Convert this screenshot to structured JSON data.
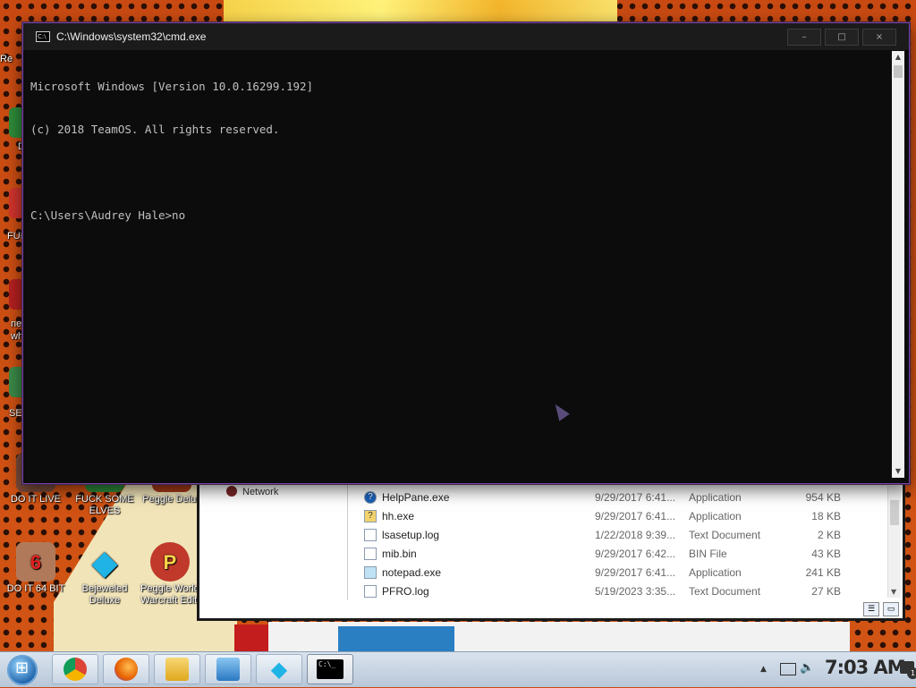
{
  "cmd": {
    "title": "C:\\Windows\\system32\\cmd.exe",
    "lines": [
      "Microsoft Windows [Version 10.0.16299.192]",
      "(c) 2018 TeamOS. All rights reserved.",
      "",
      "C:\\Users\\Audrey Hale>no"
    ],
    "controls": {
      "minimize": "–",
      "maximize": "□",
      "close": "×"
    }
  },
  "desktop": {
    "icons": [
      {
        "label": "DO IT LIVE",
        "color": "#7b4b3a",
        "glyph": ""
      },
      {
        "label": "FUCK SOME ELVES",
        "color": "#2e8b3a",
        "glyph": ""
      },
      {
        "label": "Peggle Delux",
        "color": "#a63a18",
        "glyph": "P"
      },
      {
        "label": "DO IT 64 BIT",
        "color": "#b07a5a",
        "glyph": "6"
      },
      {
        "label": "Bejeweled Deluxe",
        "color": "#1fb3e6",
        "glyph": "◆"
      },
      {
        "label": "Peggle World Warcraft Editi",
        "color": "#c0392b",
        "glyph": "P"
      }
    ],
    "edge_labels": [
      "Re",
      "D",
      "FUF",
      "ne",
      "wh",
      "SE"
    ]
  },
  "explorer": {
    "nav_item": "Network",
    "files": [
      {
        "name": "HelpPane.exe",
        "date": "9/29/2017 6:41...",
        "type": "Application",
        "size": "954 KB",
        "icon": "?"
      },
      {
        "name": "hh.exe",
        "date": "9/29/2017 6:41...",
        "type": "Application",
        "size": "18 KB",
        "icon": "?"
      },
      {
        "name": "lsasetup.log",
        "date": "1/22/2018 9:39...",
        "type": "Text Document",
        "size": "2 KB",
        "icon": ""
      },
      {
        "name": "mib.bin",
        "date": "9/29/2017 6:42...",
        "type": "BIN File",
        "size": "43 KB",
        "icon": ""
      },
      {
        "name": "notepad.exe",
        "date": "9/29/2017 6:41...",
        "type": "Application",
        "size": "241 KB",
        "icon": ""
      },
      {
        "name": "PFRO.log",
        "date": "5/19/2023 3:35...",
        "type": "Text Document",
        "size": "27 KB",
        "icon": ""
      }
    ]
  },
  "taskbar": {
    "clock": "7:03 AM",
    "notification_count": "1",
    "apps": [
      {
        "name": "chrome",
        "color": "#db4437"
      },
      {
        "name": "firefox",
        "color": "#e66000"
      },
      {
        "name": "file-explorer",
        "color": "#f2c94c"
      },
      {
        "name": "window-app",
        "color": "#3a8fd8"
      },
      {
        "name": "bejeweled",
        "color": "#1fb3e6"
      },
      {
        "name": "cmd",
        "color": "#000000"
      }
    ]
  }
}
